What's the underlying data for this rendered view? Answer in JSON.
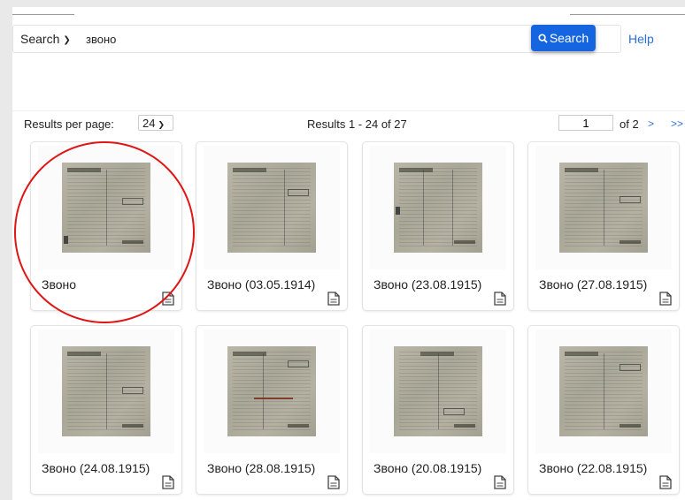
{
  "search": {
    "type_label": "Search",
    "query": "звоно",
    "button_label": "Search",
    "help_label": "Help"
  },
  "results": {
    "per_page_label": "Results per page:",
    "per_page_value": "24",
    "count_text": "Results  1 - 24 of 27",
    "current_page": "1",
    "of_pages": "of 2",
    "next_label": ">",
    "last_label": ">>"
  },
  "items": [
    {
      "title": "Звоно"
    },
    {
      "title": "Звоно (03.05.1914)"
    },
    {
      "title": "Звоно (23.08.1915)"
    },
    {
      "title": "Звоно (27.08.1915)"
    },
    {
      "title": "Звоно (24.08.1915)"
    },
    {
      "title": "Звоно (28.08.1915)"
    },
    {
      "title": "Звоно (20.08.1915)"
    },
    {
      "title": "Звоно (22.08.1915)"
    }
  ],
  "colors": {
    "accent": "#1565e0",
    "link": "#2a6fdb",
    "annotation": "#e01515"
  }
}
